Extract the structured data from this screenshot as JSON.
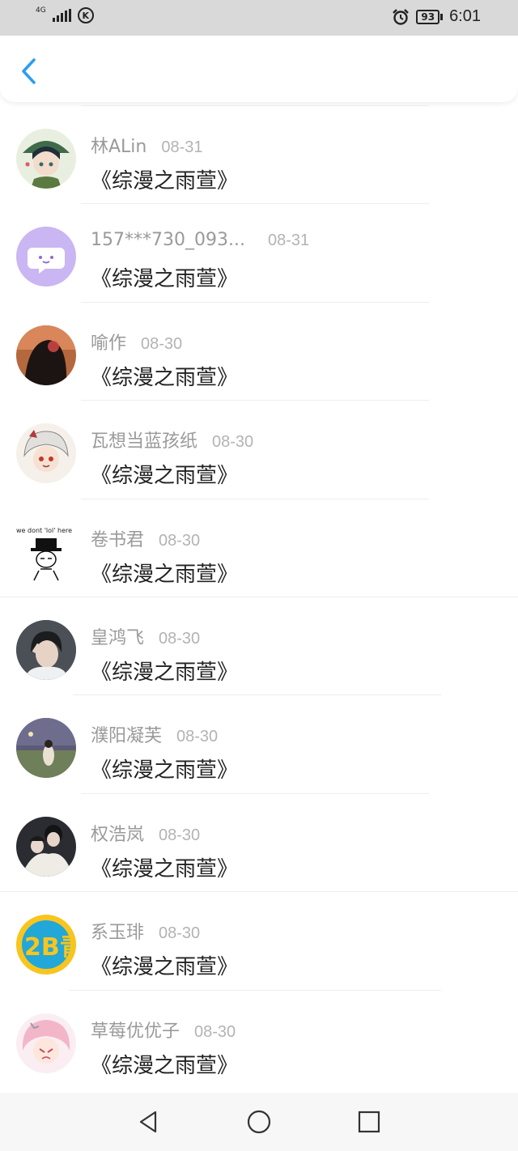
{
  "status_bar": {
    "network_label": "4G",
    "carrier_icon_letter": "K",
    "battery_level": "93",
    "time": "6:01"
  },
  "header": {
    "back_icon": "chevron-left-icon",
    "accent_color": "#2a9df4"
  },
  "items": [
    {
      "name": "林ALin",
      "date": "08-31",
      "title": "《综漫之雨萱》"
    },
    {
      "name": "157***730_093...",
      "date": "08-31",
      "title": "《综漫之雨萱》"
    },
    {
      "name": "喻作",
      "date": "08-30",
      "title": "《综漫之雨萱》"
    },
    {
      "name": "瓦想当蓝孩纸",
      "date": "08-30",
      "title": "《综漫之雨萱》"
    },
    {
      "name": "卷书君",
      "date": "08-30",
      "title": "《综漫之雨萱》"
    },
    {
      "name": "皇鸿飞",
      "date": "08-30",
      "title": "《综漫之雨萱》"
    },
    {
      "name": "濮阳凝芙",
      "date": "08-30",
      "title": "《综漫之雨萱》"
    },
    {
      "name": "权浩岚",
      "date": "08-30",
      "title": "《综漫之雨萱》"
    },
    {
      "name": "系玉琲",
      "date": "08-30",
      "title": "《综漫之雨萱》"
    },
    {
      "name": "草莓优优子",
      "date": "08-30",
      "title": "《综漫之雨萱》"
    }
  ],
  "avatar_images": {
    "item_5_caption": "we dont 'lol' here",
    "item_9_caption": "2B青年"
  },
  "nav_bar": {
    "back_icon": "triangle-back-icon",
    "home_icon": "circle-home-icon",
    "recents_icon": "square-recents-icon"
  }
}
